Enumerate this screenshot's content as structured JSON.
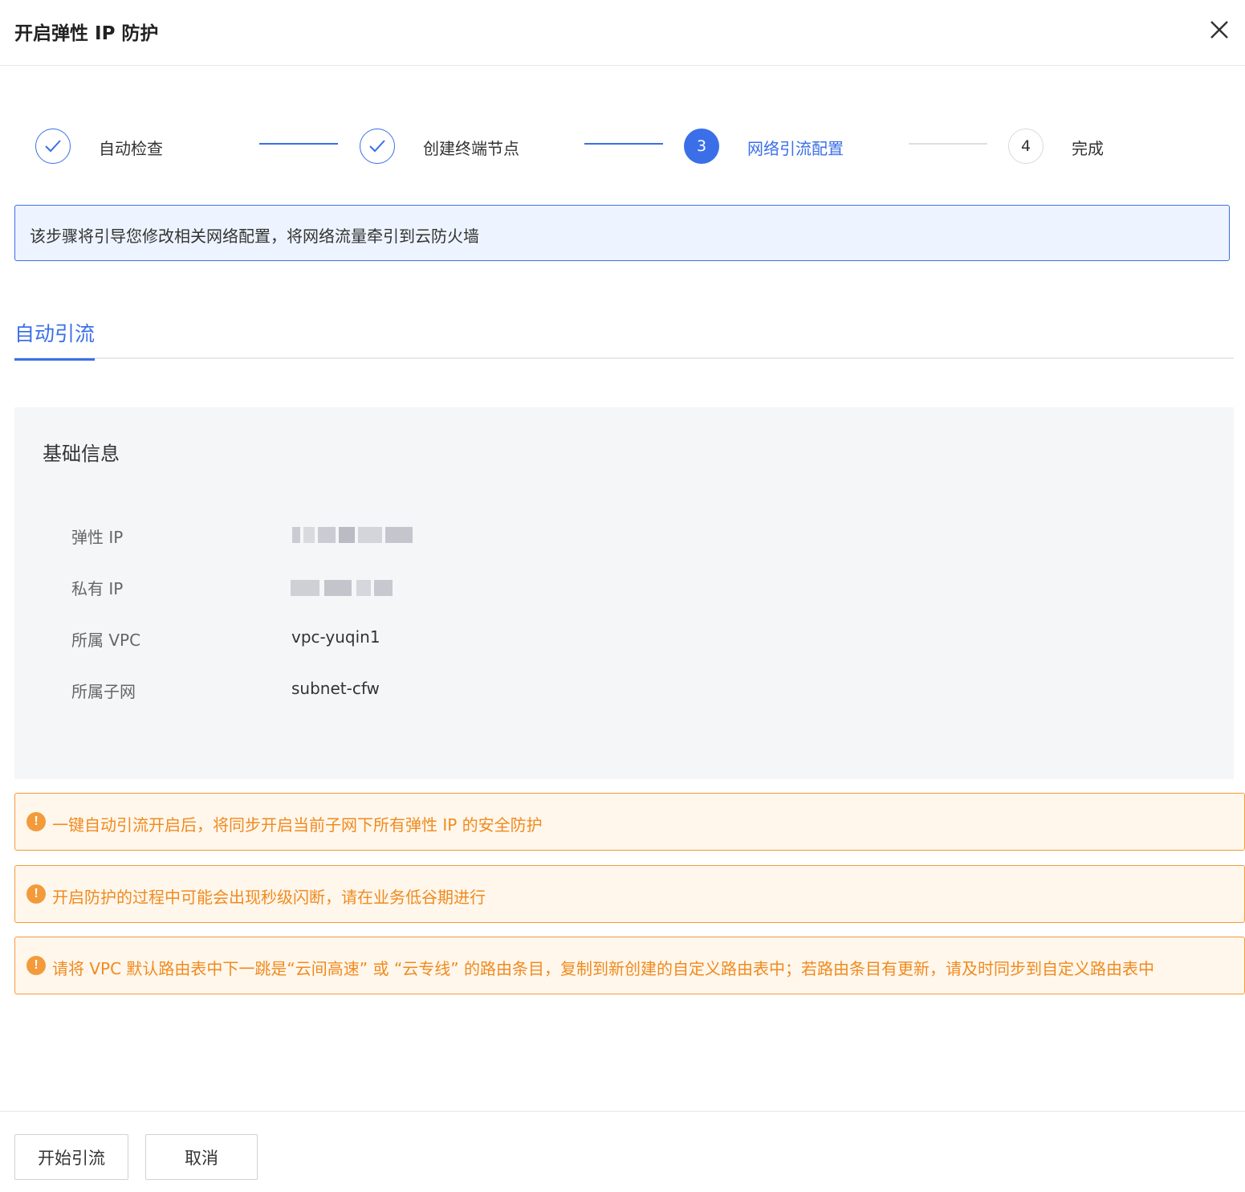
{
  "dialog": {
    "title": "开启弹性 IP 防护",
    "close_icon": "close-icon"
  },
  "steps": [
    {
      "label": "自动检查",
      "status": "done",
      "icon": "check-icon"
    },
    {
      "label": "创建终端节点",
      "status": "done",
      "icon": "check-icon"
    },
    {
      "label": "网络引流配置",
      "status": "active",
      "number": "3"
    },
    {
      "label": "完成",
      "status": "todo",
      "number": "4"
    }
  ],
  "info_banner": "该步骤将引导您修改相关网络配置，将网络流量牵引到云防火墙",
  "tabs": [
    {
      "label": "自动引流",
      "active": true
    }
  ],
  "basic_info": {
    "title": "基础信息",
    "fields": [
      {
        "label": "弹性 IP",
        "value": ""
      },
      {
        "label": "私有 IP",
        "value": ""
      },
      {
        "label": "所属 VPC",
        "value": "vpc-yuqin1"
      },
      {
        "label": "所属子网",
        "value": "subnet-cfw"
      }
    ]
  },
  "warnings": [
    "一键自动引流开启后，将同步开启当前子网下所有弹性 IP 的安全防护",
    "开启防护的过程中可能会出现秒级闪断，请在业务低谷期进行",
    "请将 VPC 默认路由表中下一跳是“云间高速” 或 “云专线” 的路由条目，复制到新创建的自定义路由表中；若路由条目有更新，请及时同步到自定义路由表中"
  ],
  "warning_icon_glyph": "!",
  "footer": {
    "start_label": "开始引流",
    "cancel_label": "取消"
  },
  "colors": {
    "primary": "#3b6fe8",
    "warning": "#f39b3b",
    "warning_text": "#f08a1e",
    "panel_bg": "#f5f6f8",
    "info_bg": "#eef4ff"
  }
}
